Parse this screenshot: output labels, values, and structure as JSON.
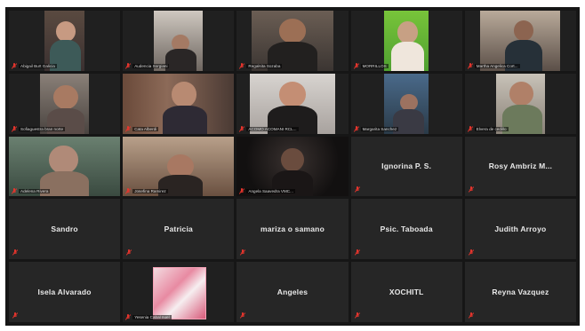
{
  "participants": [
    {
      "name": "Abigail Burt Galicia",
      "kind": "video"
    },
    {
      "name": "Audencia Sorgiani",
      "kind": "video"
    },
    {
      "name": "Regalsita Sozaba",
      "kind": "video"
    },
    {
      "name": "MORRILLOS",
      "kind": "video"
    },
    {
      "name": "Martha Angelica Cort...",
      "kind": "video"
    },
    {
      "name": "Sofiaguestra bran norte",
      "kind": "video"
    },
    {
      "name": "Cata Alberdi",
      "kind": "video"
    },
    {
      "name": "ACOMO ACOMANI RCL...",
      "kind": "video"
    },
    {
      "name": "Margarita Sanchez",
      "kind": "video"
    },
    {
      "name": "Elvera de cedillo",
      "kind": "video"
    },
    {
      "name": "Adelena Rivera",
      "kind": "video"
    },
    {
      "name": "Josefina Ramirez",
      "kind": "video"
    },
    {
      "name": "Angela Saavedra VMC...",
      "kind": "video"
    },
    {
      "name": "Ignorina P. S.",
      "kind": "name"
    },
    {
      "name": "Rosy Ambriz M...",
      "kind": "name"
    },
    {
      "name": "Sandro",
      "kind": "name"
    },
    {
      "name": "Patricia",
      "kind": "name"
    },
    {
      "name": "mariza o samano",
      "kind": "name"
    },
    {
      "name": "Psic. Taboada",
      "kind": "name"
    },
    {
      "name": "Judith Arroyo",
      "kind": "name"
    },
    {
      "name": "Isela Alvarado",
      "kind": "name"
    },
    {
      "name": "Yesenia Cabal nuel",
      "kind": "photo"
    },
    {
      "name": "Angeles",
      "kind": "name"
    },
    {
      "name": "XOCHITL",
      "kind": "name"
    },
    {
      "name": "Reyna Vazquez",
      "kind": "name"
    }
  ],
  "colors": {
    "background": "#161616",
    "tile": "#262626",
    "muted_icon": "#e8352d",
    "name_text": "#e9e9e9"
  },
  "icons": {
    "muted": "muted-mic-icon"
  }
}
